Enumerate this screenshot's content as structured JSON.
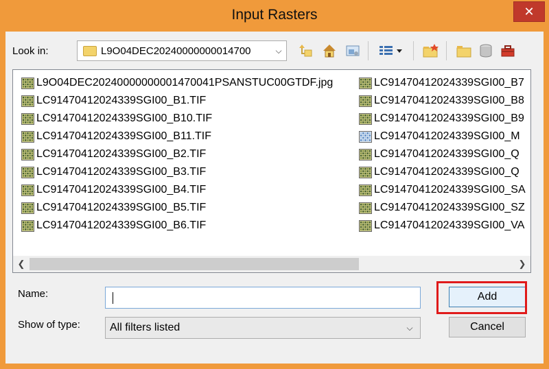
{
  "window": {
    "title": "Input Rasters",
    "close_symbol": "✕",
    "accent_color": "#f09a3b"
  },
  "lookin": {
    "label": "Look in:",
    "value": "L9O04DEC20240000000014700"
  },
  "toolbar": {
    "icons": [
      "up-level-icon",
      "home-icon",
      "connect-icon",
      "view-menu-icon",
      "new-folder-icon",
      "folder-icon",
      "database-icon",
      "toolbox-icon"
    ]
  },
  "files": {
    "column1": [
      "L9O04DEC20240000000001470041PSANSTUC00GTDF.jpg",
      "LC91470412024339SGI00_B1.TIF",
      "LC91470412024339SGI00_B10.TIF",
      "LC91470412024339SGI00_B11.TIF",
      "LC91470412024339SGI00_B2.TIF",
      "LC91470412024339SGI00_B3.TIF",
      "LC91470412024339SGI00_B4.TIF",
      "LC91470412024339SGI00_B5.TIF",
      "LC91470412024339SGI00_B6.TIF"
    ],
    "column2": [
      "LC91470412024339SGI00_B7",
      "LC91470412024339SGI00_B8",
      "LC91470412024339SGI00_B9",
      "LC91470412024339SGI00_M",
      "LC91470412024339SGI00_Q",
      "LC91470412024339SGI00_Q",
      "LC91470412024339SGI00_SA",
      "LC91470412024339SGI00_SZ",
      "LC91470412024339SGI00_VA"
    ]
  },
  "form": {
    "name_label": "Name:",
    "name_value": "",
    "type_label": "Show of type:",
    "type_value": "All filters listed"
  },
  "buttons": {
    "add": "Add",
    "cancel": "Cancel"
  }
}
